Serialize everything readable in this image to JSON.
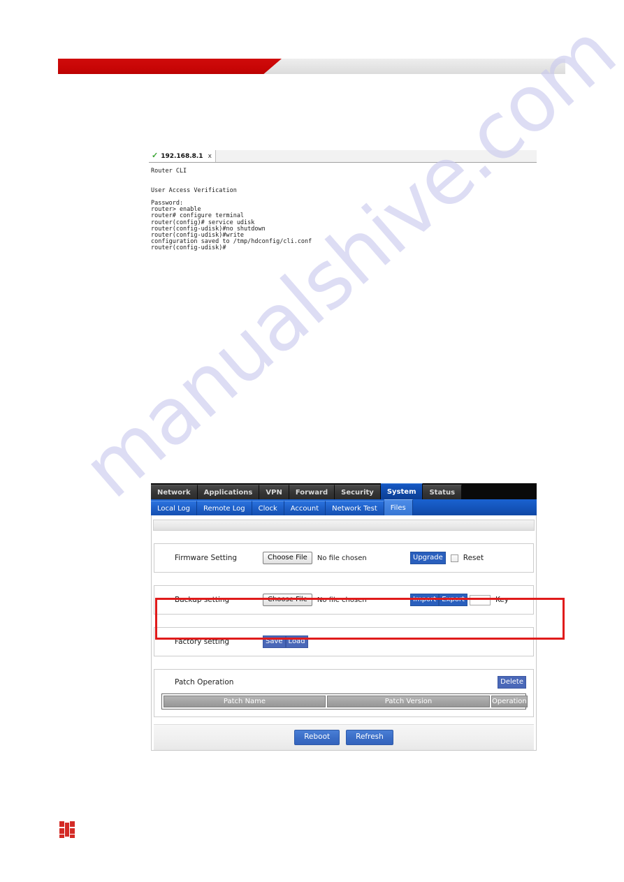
{
  "page": {
    "watermark_text": "manualshive.com",
    "header_accent_color": "#c80606",
    "logo_color": "#d32b26",
    "highlight_color": "#e01b1b"
  },
  "terminal": {
    "tab_label": "192.168.8.1",
    "tab_close_label": "x",
    "status_icon": "check-icon",
    "transcript": "Router CLI\n\n\nUser Access Verification\n\nPassword:\nrouter> enable\nrouter# configure terminal\nrouter(config)# service udisk\nrouter(config-udisk)#no shutdown\nrouter(config-udisk)#write\nconfiguration saved to /tmp/hdconfig/cli.conf\nrouter(config-udisk)#"
  },
  "router_ui": {
    "primary_tabs": [
      {
        "label": "Network",
        "active": false
      },
      {
        "label": "Applications",
        "active": false
      },
      {
        "label": "VPN",
        "active": false
      },
      {
        "label": "Forward",
        "active": false
      },
      {
        "label": "Security",
        "active": false
      },
      {
        "label": "System",
        "active": true
      },
      {
        "label": "Status",
        "active": false
      }
    ],
    "secondary_tabs": [
      {
        "label": "Local Log",
        "active": false
      },
      {
        "label": "Remote Log",
        "active": false
      },
      {
        "label": "Clock",
        "active": false
      },
      {
        "label": "Account",
        "active": false
      },
      {
        "label": "Network Test",
        "active": false
      },
      {
        "label": "Files",
        "active": true
      }
    ],
    "firmware": {
      "label": "Firmware Setting",
      "choose_file_label": "Choose File",
      "file_status": "No file chosen",
      "upgrade_label": "Upgrade",
      "reset_label": "Reset",
      "reset_checked": false
    },
    "backup": {
      "label": "Backup setting",
      "choose_file_label": "Choose File",
      "file_status": "No file chosen",
      "import_label": "Import",
      "export_label": "Export",
      "key_value": "",
      "key_label": "Key"
    },
    "factory": {
      "label": "Factory setting",
      "save_label": "Save",
      "load_label": "Load"
    },
    "patch": {
      "title": "Patch Operation",
      "delete_label": "Delete",
      "columns": [
        "Patch Name",
        "Patch Version",
        "Operation"
      ],
      "rows": []
    },
    "footer_actions": {
      "reboot_label": "Reboot",
      "refresh_label": "Refresh"
    }
  }
}
